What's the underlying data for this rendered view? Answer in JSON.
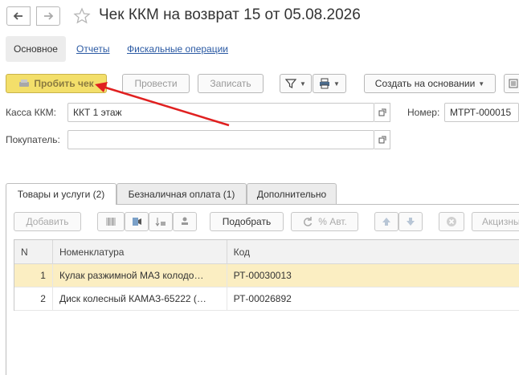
{
  "window": {
    "title": "Чек ККМ на возврат 15 от 05.08.2026"
  },
  "nav": {
    "back_icon": "arrow-left-icon",
    "forward_icon": "arrow-right-icon",
    "favorite_icon": "star-icon"
  },
  "top_tabs": {
    "main": "Основное",
    "reports": "Отчеты",
    "fiscal": "Фискальные операции"
  },
  "toolbar": {
    "punch_check": "Пробить чек",
    "post": "Провести",
    "save": "Записать",
    "filter_icon": "filter-icon",
    "print_icon": "printer-icon",
    "create_based_on": "Создать на основании"
  },
  "fields": {
    "kassa_label": "Касса ККМ:",
    "kassa_value": "ККТ 1 этаж",
    "number_label": "Номер:",
    "number_value": "МТРТ-000015",
    "buyer_label": "Покупатель:",
    "buyer_value": ""
  },
  "page_tabs": [
    {
      "label": "Товары и услуги (2)"
    },
    {
      "label": "Безналичная оплата (1)"
    },
    {
      "label": "Дополнительно"
    }
  ],
  "table_toolbar": {
    "add": "Добавить",
    "pick": "Подобрать",
    "auto_percent": "% Авт.",
    "excise": "Акцизны"
  },
  "table": {
    "columns": [
      "N",
      "Номенклатура",
      "Код"
    ],
    "rows": [
      {
        "n": "1",
        "nomenclature": "Кулак разжимной МАЗ колодо…",
        "code": "РТ-00030013"
      },
      {
        "n": "2",
        "nomenclature": "Диск колесный КАМАЗ-65222 (…",
        "code": "РТ-00026892"
      }
    ]
  },
  "colors": {
    "accent_button": "#f3df6a",
    "selected_row": "#fbeec2",
    "link": "#2a59a3",
    "annotation_arrow": "#e02020"
  }
}
